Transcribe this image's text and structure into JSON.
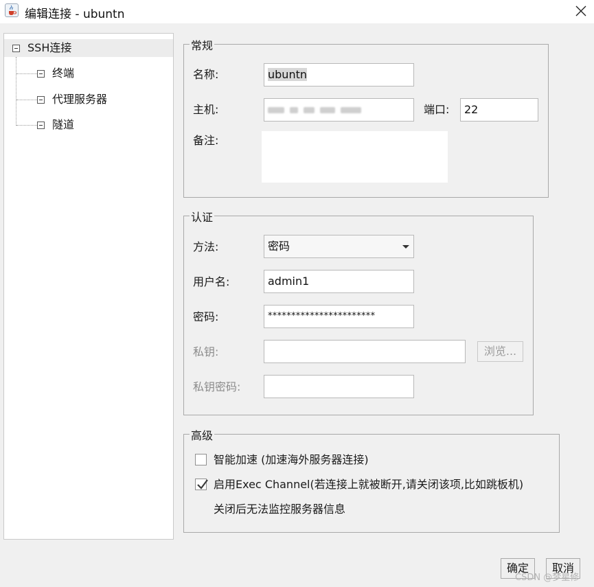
{
  "window": {
    "title": "编辑连接 - ubuntn",
    "icon": "java-cup-icon",
    "close_icon": "close-icon"
  },
  "tree": {
    "root": "SSH连接",
    "children": [
      "终端",
      "代理服务器",
      "隧道"
    ]
  },
  "general": {
    "legend": "常规",
    "name_label": "名称:",
    "name_value": "ubuntn",
    "host_label": "主机:",
    "port_label": "端口:",
    "port_value": "22",
    "note_label": "备注:",
    "note_value": ""
  },
  "auth": {
    "legend": "认证",
    "method_label": "方法:",
    "method_value": "密码",
    "username_label": "用户名:",
    "username_value": "admin1",
    "password_label": "密码:",
    "password_value": "***********************",
    "private_key_label": "私钥:",
    "private_key_value": "",
    "browse_button": "浏览...",
    "key_password_label": "私钥密码:",
    "key_password_value": ""
  },
  "advanced": {
    "legend": "高级",
    "smart_accel_label": "智能加速 (加速海外服务器连接)",
    "smart_accel_checked": false,
    "exec_channel_label": "启用Exec Channel(若连接上就被断开,请关闭该项,比如跳板机)",
    "exec_channel_checked": true,
    "exec_channel_note": "关闭后无法监控服务器信息"
  },
  "buttons": {
    "ok": "确定",
    "cancel": "取消"
  },
  "watermark": "CSDN @梦星修"
}
